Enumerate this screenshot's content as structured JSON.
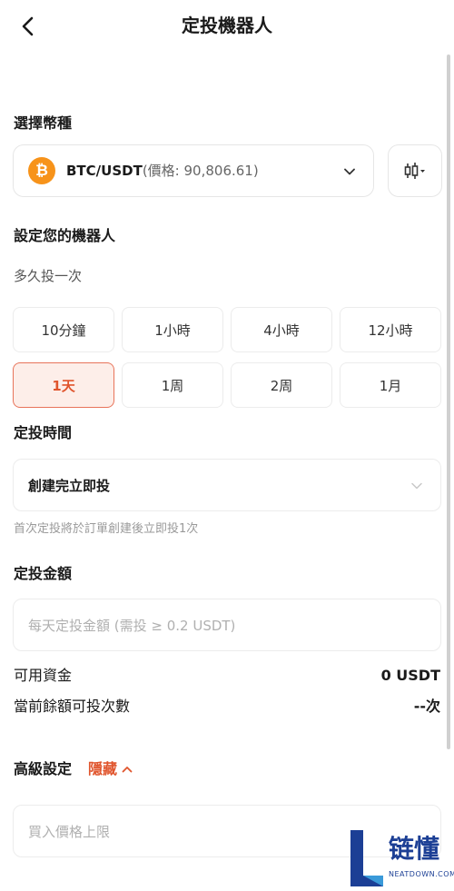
{
  "header": {
    "title": "定投機器人"
  },
  "coin_section": {
    "label": "選擇幣種",
    "pair": "BTC/USDT",
    "price": "(價格: 90,806.61)",
    "icon": "bitcoin-icon",
    "icon_glyph": "₿"
  },
  "robot_section": {
    "label": "設定您的機器人",
    "frequency_label": "多久投一次",
    "frequencies": [
      "10分鐘",
      "1小時",
      "4小時",
      "12小時",
      "1天",
      "1周",
      "2周",
      "1月"
    ],
    "selected_frequency": "1天"
  },
  "time_section": {
    "label": "定投時間",
    "value": "創建完立即投",
    "hint": "首次定投將於訂單創建後立即投1次"
  },
  "amount_section": {
    "label": "定投金額",
    "placeholder": "每天定投金額 (需投 ≥ 0.2 USDT)"
  },
  "balance": {
    "available_label": "可用資金",
    "available_value": "0 USDT",
    "times_label": "當前餘額可投次數",
    "times_value": "--次"
  },
  "advanced": {
    "label": "高級設定",
    "toggle": "隱藏",
    "max_price_placeholder": "買入價格上限"
  },
  "watermark": {
    "brand": "链懂",
    "domain": "NEATDOWN.COM"
  },
  "colors": {
    "accent": "#e0552d",
    "selected_bg": "#fdeee9",
    "btc": "#f7931a",
    "watermark": "#1c3f95"
  }
}
